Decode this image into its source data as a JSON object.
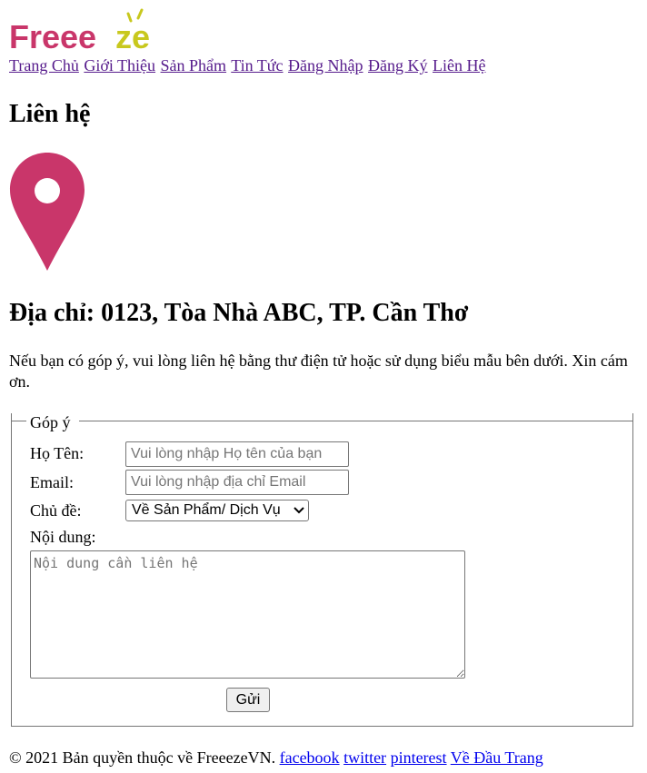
{
  "brand": {
    "logo_text": "Freeeze",
    "logo_colors": [
      "#c9366a",
      "#c8c81e"
    ]
  },
  "nav": {
    "items": [
      {
        "label": "Trang Chủ"
      },
      {
        "label": "Giới Thiệu"
      },
      {
        "label": "Sản Phẩm"
      },
      {
        "label": "Tin Tức"
      },
      {
        "label": "Đăng Nhập"
      },
      {
        "label": "Đăng Ký"
      },
      {
        "label": "Liên Hệ"
      }
    ]
  },
  "page": {
    "title": "Liên hệ",
    "pin_icon_color": "#c9366a",
    "address": "Địa chỉ: 0123, Tòa Nhà ABC, TP. Cần Thơ",
    "intro": "Nếu bạn có góp ý, vui lòng liên hệ bằng thư điện tử hoặc sử dụng biểu mẫu bên dưới. Xin cám ơn."
  },
  "form": {
    "legend": "Góp ý",
    "name": {
      "label": "Họ Tên:",
      "value": "",
      "placeholder": "Vui lòng nhập Họ tên của bạn"
    },
    "email": {
      "label": "Email:",
      "value": "",
      "placeholder": "Vui lòng nhập địa chỉ Email"
    },
    "subject": {
      "label": "Chủ đề:",
      "selected": "Về Sản Phẩm/ Dịch Vụ"
    },
    "message": {
      "label": "Nội dung:",
      "value": "",
      "placeholder": "Nội dung cần liên hệ"
    },
    "submit_label": "Gửi"
  },
  "footer": {
    "copyright": "© 2021 Bản quyền thuộc về FreeezeVN.",
    "links": [
      "facebook",
      "twitter",
      "pinterest",
      "Về Đầu Trang"
    ]
  }
}
